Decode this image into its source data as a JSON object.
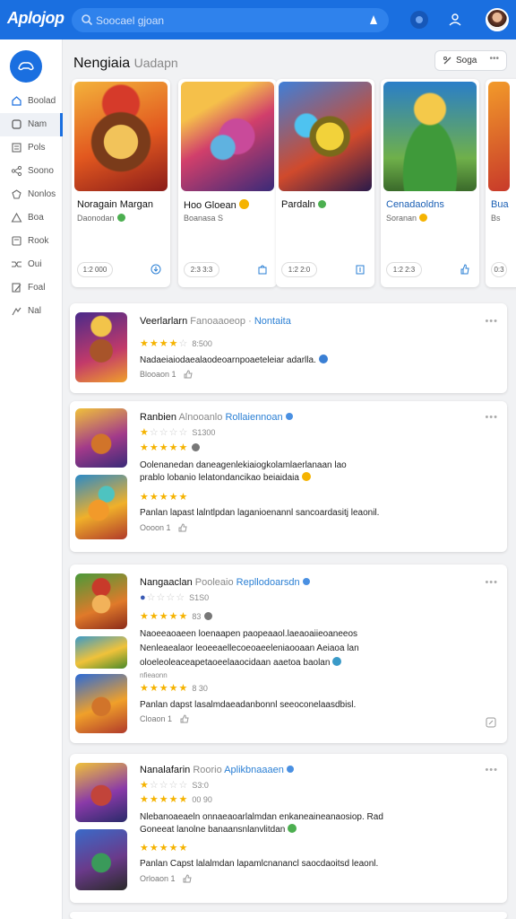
{
  "app": {
    "logo_text": "Aplojop"
  },
  "search": {
    "placeholder": "Soocael gjoan"
  },
  "colors": {
    "brand": "#1a6fe0",
    "star": "#f5b301",
    "link": "#2a7fd4"
  },
  "sidebar": {
    "items": [
      {
        "label": "Boolad",
        "icon": "home-icon"
      },
      {
        "label": "Nam",
        "icon": "apps-icon"
      },
      {
        "label": "Pols",
        "icon": "list-icon"
      },
      {
        "label": "Soono",
        "icon": "share-icon"
      },
      {
        "label": "Nonlos",
        "icon": "bookmark-icon"
      },
      {
        "label": "Boa",
        "icon": "triangle-icon"
      },
      {
        "label": "Rook",
        "icon": "book-icon"
      },
      {
        "label": "Oui",
        "icon": "shuffle-icon"
      },
      {
        "label": "Foal",
        "icon": "edit-icon"
      },
      {
        "label": "Nal",
        "icon": "flag-icon"
      }
    ]
  },
  "main": {
    "title": "Nengiaia",
    "title_sub": "Uadapn",
    "sort_label": "Soga",
    "sort_more": "•••"
  },
  "games": [
    {
      "name": "Noragain Margan",
      "sub": "Daonodan",
      "badge": "#4caf50",
      "pill": "1:2 000"
    },
    {
      "name": "Hoo Gloean",
      "sub": "Boanasa S",
      "badge": "#f5b301",
      "pill": "2:3 3:3"
    },
    {
      "name": "Pardaln",
      "sub": "",
      "badge": "#4caf50",
      "pill": "1:2 2:0"
    },
    {
      "name": "Cenadaoldns",
      "sub": "Soranan",
      "badge": "#f5b301",
      "pill": "1:2 2:3"
    },
    {
      "name": "Bua",
      "sub": "Bs",
      "badge": "",
      "pill": "0:3"
    }
  ],
  "reviews": [
    {
      "title": "Veerlarlarn",
      "title_muted": "Fanoaaoeop",
      "title_link": "Nontaita",
      "stars_on": 4,
      "stars_off": 1,
      "rating": "8:500",
      "text": "Nadaeiaiodaealaodeoarnpoaeteleiar adarlla.",
      "meta": "Blooaon 1"
    },
    {
      "title": "Ranbien",
      "title_muted": "Alnooanlo",
      "title_link": "Rollaiennoan",
      "stars_on": 1,
      "stars_off": 4,
      "rating": "S1300",
      "stars2_on": 5,
      "stars2_off": 0,
      "text1": "Oolenanedan daneagenlekiaiogkolamlaerlanaan lao",
      "text2": "prablo lobanio lelatondancikao beiaidaia",
      "stars3_on": 5,
      "text3": "Panlan lapast lalntlpdan laganioenannl sancoardasitj leaonil.",
      "meta": "Oooon 1"
    },
    {
      "title": "Nangaaclan",
      "title_muted": "Pooleaio",
      "title_link": "Repllodoarsdn",
      "stars_on": 1,
      "stars_off": 4,
      "rating": "S1S0",
      "stars2_on": 5,
      "stars2_off": 0,
      "rating2": "83",
      "text1": "Naoeeaoaeen loenaapen paopeaaol.laeaoaiieoaneeos",
      "text2": "Nenleaealaor leoeeaellecoeoaeeleniaooaan Aeiaoa lan",
      "text3": "oloeleoleaceapetaoeelaaocidaan aaetoa baolan",
      "tiny": "nfieaonn",
      "stars3_on": 5,
      "rating3": "8 30",
      "text4": "Panlan dapst lasalmdaeadanbonnl seeoconelaasdbisl.",
      "meta": "Cloaon 1"
    },
    {
      "title": "Nanalafarin",
      "title_muted": "Roorio",
      "title_link": "Aplikbnaaaen",
      "stars_on": 1,
      "stars_off": 4,
      "rating": "S3:0",
      "stars2_on": 5,
      "stars2_off": 0,
      "rating2": "00 90",
      "text1": "Nlebanoaeaeln onnaeaoarlalmdan enkaneaineanaosiop. Rad",
      "text2": "Goneeat lanolne banaansnlanvlitdan",
      "stars3_on": 5,
      "text3": "Panlan Capst lalalmdan lapamlcnanancl saocdaoitsd leaonl.",
      "meta": "Orloaon 1"
    }
  ]
}
